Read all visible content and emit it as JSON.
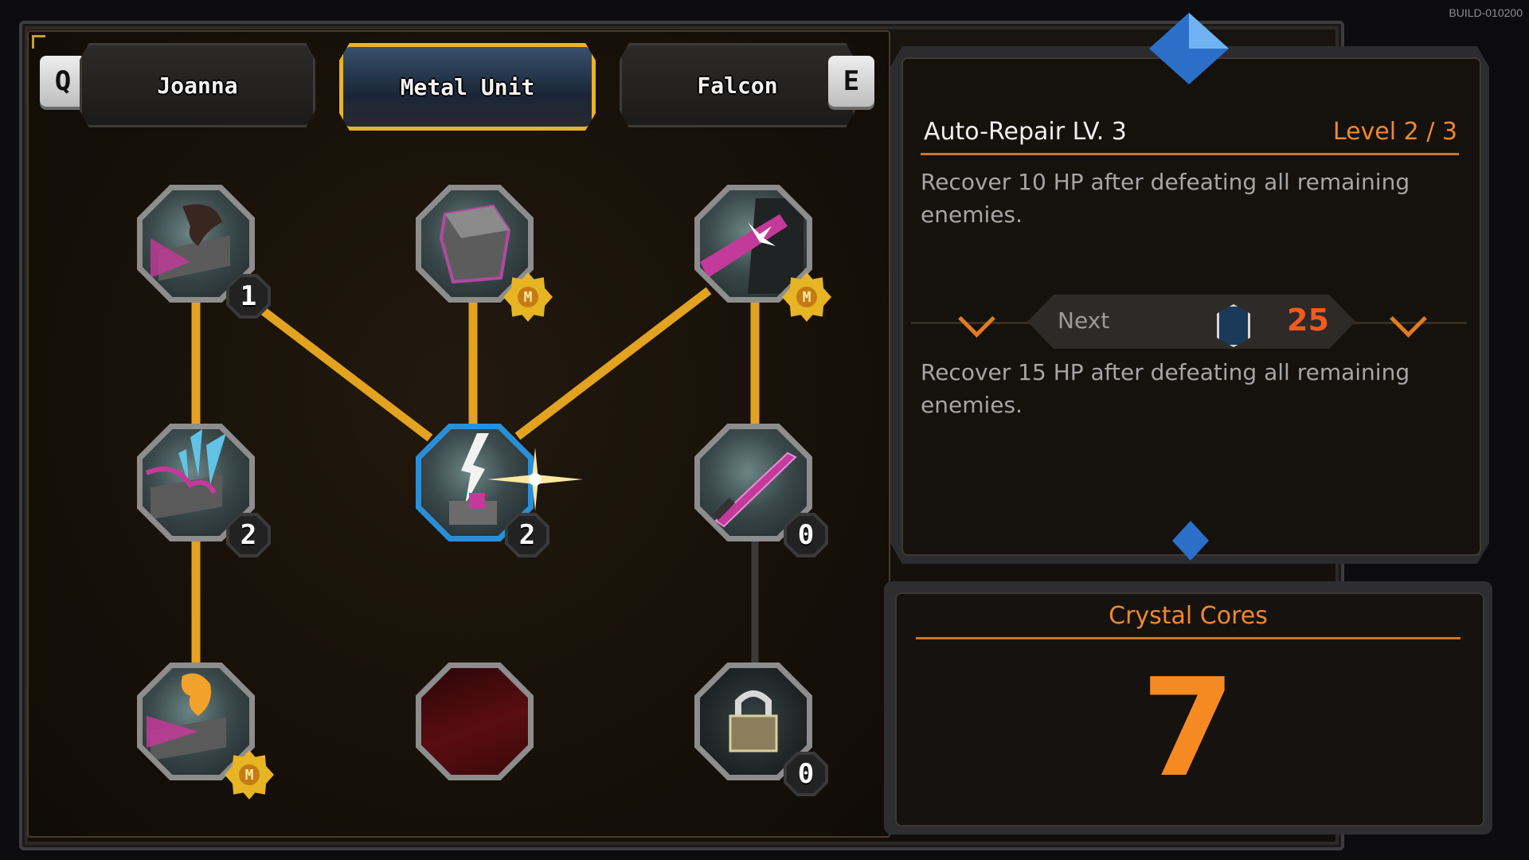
{
  "build_label": "BUILD-010200",
  "tabs": {
    "prev_key": "Q",
    "next_key": "E",
    "items": [
      {
        "label": "Joanna",
        "active": false
      },
      {
        "label": "Metal Unit",
        "active": true
      },
      {
        "label": "Falcon",
        "active": false
      }
    ]
  },
  "tree": {
    "nodes": [
      {
        "name": "skill-node-r1c1",
        "rank": "1",
        "badge": "rank",
        "icon": "shadow-hand-icon"
      },
      {
        "name": "skill-node-r1c2",
        "rank": "M",
        "badge": "max",
        "icon": "armor-cube-icon"
      },
      {
        "name": "skill-node-r1c3",
        "rank": "M",
        "badge": "max",
        "icon": "shatter-icon"
      },
      {
        "name": "skill-node-r2c1",
        "rank": "2",
        "badge": "rank",
        "icon": "ice-shard-icon"
      },
      {
        "name": "skill-node-r2c2",
        "rank": "2",
        "badge": "rank",
        "icon": "lightning-repair-icon",
        "selected": true
      },
      {
        "name": "skill-node-r2c3",
        "rank": "0",
        "badge": "rank",
        "icon": "sword-icon"
      },
      {
        "name": "skill-node-r3c1",
        "rank": "M",
        "badge": "max",
        "icon": "flame-wave-icon"
      },
      {
        "name": "skill-node-r3c2",
        "rank": "",
        "badge": "none",
        "icon": "empty-slot-icon"
      },
      {
        "name": "skill-node-r3c3",
        "rank": "0",
        "badge": "rank",
        "icon": "padlock-icon"
      }
    ],
    "link_color": "#e3a21f",
    "inactive_link_color": "#3a3a3a"
  },
  "detail": {
    "title": "Auto-Repair LV. 3",
    "level": "Level 2 / 3",
    "current_desc": "Recover 10 HP after defeating all remaining enemies.",
    "next_label": "Next",
    "next_cost": "25",
    "next_desc": "Recover 15 HP after defeating all remaining enemies.",
    "currency_icon": "crystal-gem-icon"
  },
  "cores": {
    "title": "Crystal Cores",
    "value": "7"
  },
  "colors": {
    "accent": "#f0882c",
    "gold": "#e7b424",
    "selected": "#2a8fd9",
    "cost": "#f25a1f"
  }
}
